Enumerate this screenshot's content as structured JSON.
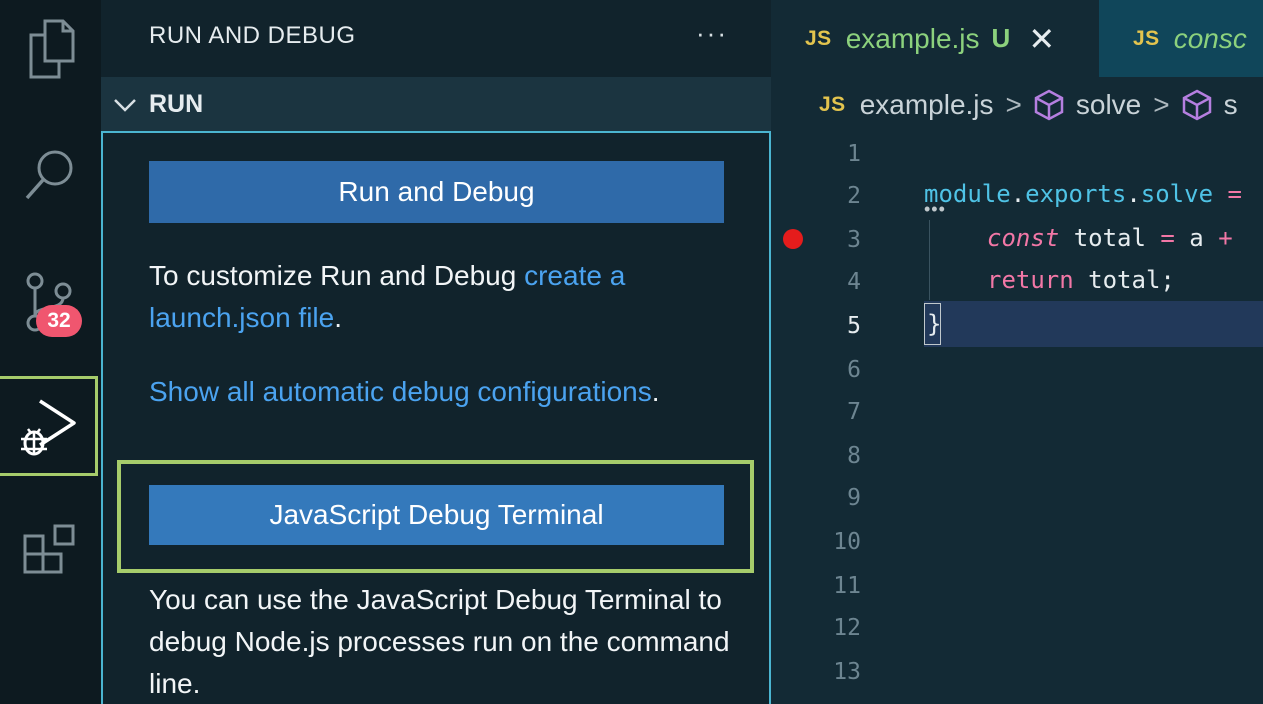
{
  "activity_bar": {
    "badge_count": "32",
    "items": [
      {
        "icon": "files-icon"
      },
      {
        "icon": "search-icon"
      },
      {
        "icon": "source-control-icon"
      },
      {
        "icon": "run-debug-icon"
      },
      {
        "icon": "extensions-icon"
      }
    ]
  },
  "sidebar": {
    "title": "RUN AND DEBUG",
    "more_label": "···",
    "section": {
      "title": "RUN",
      "run_button_label": "Run and Debug",
      "customize_text": "To customize Run and Debug ",
      "customize_link": "create a launch.json file",
      "customize_end": ".",
      "show_link": "Show all automatic debug configurations",
      "show_end": ".",
      "js_terminal_button_label": "JavaScript Debug Terminal",
      "js_terminal_desc": "You can use the JavaScript Debug Terminal to debug Node.js processes run on the command line."
    }
  },
  "editor": {
    "tabs": [
      {
        "icon_label": "JS",
        "name": "example.js",
        "status": "U",
        "close": "✕"
      },
      {
        "icon_label": "JS",
        "name": "consc"
      }
    ],
    "breadcrumb": {
      "icon_label": "JS",
      "file": "example.js",
      "sep": ">",
      "symbol1": "solve",
      "symbol2": "s"
    },
    "line_numbers": [
      "1",
      "2",
      "3",
      "4",
      "5",
      "6",
      "7",
      "8",
      "9",
      "10",
      "11",
      "12",
      "13"
    ],
    "active_line": 5,
    "breakpoint_line": 3,
    "code": {
      "l2_a": "module",
      "l2_dot1": ".",
      "l2_b": "exports",
      "l2_dot2": ".",
      "l2_c": "solve",
      "l2_eq": " =",
      "l3_kw": "const",
      "l3_rest": " total ",
      "l3_eq": "=",
      "l3_a": " a ",
      "l3_plus": "+",
      "l4_kw": "return",
      "l4_rest": " total;",
      "l5": "}"
    }
  },
  "colors": {
    "accent_highlight": "#a6cc6b",
    "button": "#2f6aa9",
    "link": "#4ba3f0",
    "badge": "#f0566f",
    "breakpoint": "#e51c1c"
  }
}
